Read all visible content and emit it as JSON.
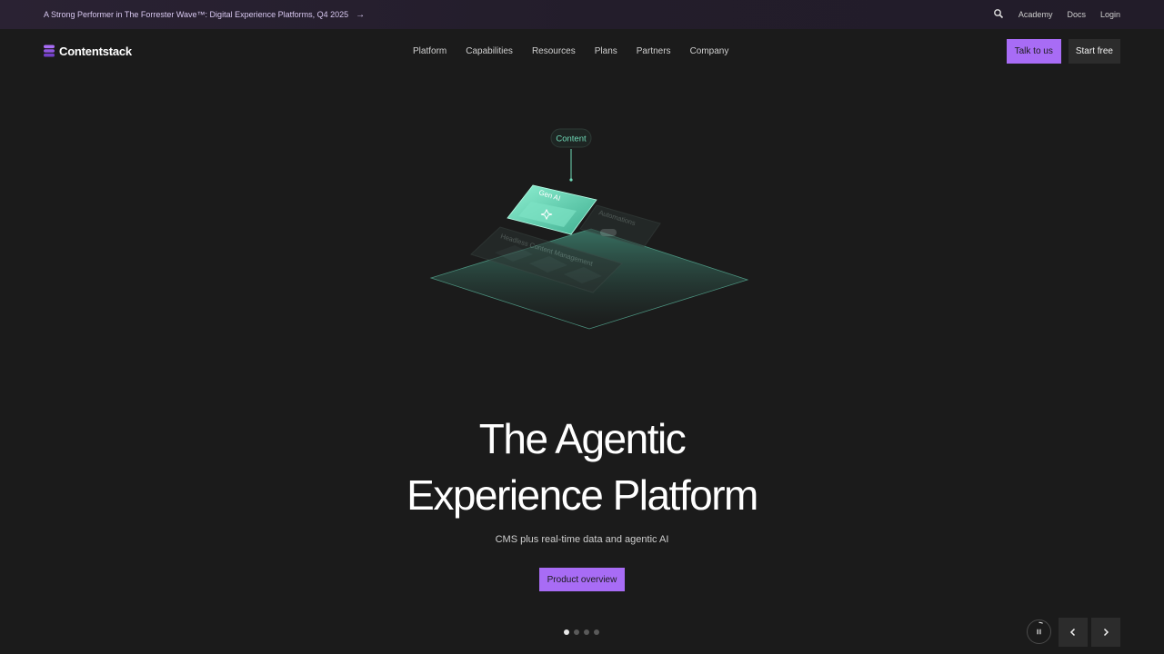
{
  "announcement": {
    "text": "A Strong Performer in The Forrester Wave™: Digital Experience Platforms, Q4 2025",
    "arrow_icon": "arrow-right-icon"
  },
  "utility_nav": {
    "search_icon": "search-icon",
    "links": [
      "Academy",
      "Docs",
      "Login"
    ]
  },
  "brand": {
    "name": "Contentstack",
    "accent": "#a86cf5"
  },
  "main_nav": {
    "items": [
      "Platform",
      "Capabilities",
      "Resources",
      "Plans",
      "Partners",
      "Company"
    ],
    "talk_label": "Talk to us",
    "start_label": "Start free"
  },
  "illustration": {
    "top_label": "Content",
    "cards": [
      "Gen AI",
      "Automations",
      "Headless Content Management"
    ],
    "accent": "#5fd0b0"
  },
  "hero": {
    "title_line1": "The Agentic",
    "title_line2": "Experience Platform",
    "subtitle": "CMS plus real-time data and agentic AI",
    "cta_label": "Product overview"
  },
  "carousel": {
    "slide_count": 4,
    "active_index": 0,
    "pause_icon": "pause-icon",
    "prev_icon": "chevron-left-icon",
    "next_icon": "chevron-right-icon"
  },
  "colors": {
    "background": "#1b1b1b",
    "topbar": "#2a2233",
    "button_primary": "#a86cf5",
    "button_secondary": "#2c2c2c"
  }
}
